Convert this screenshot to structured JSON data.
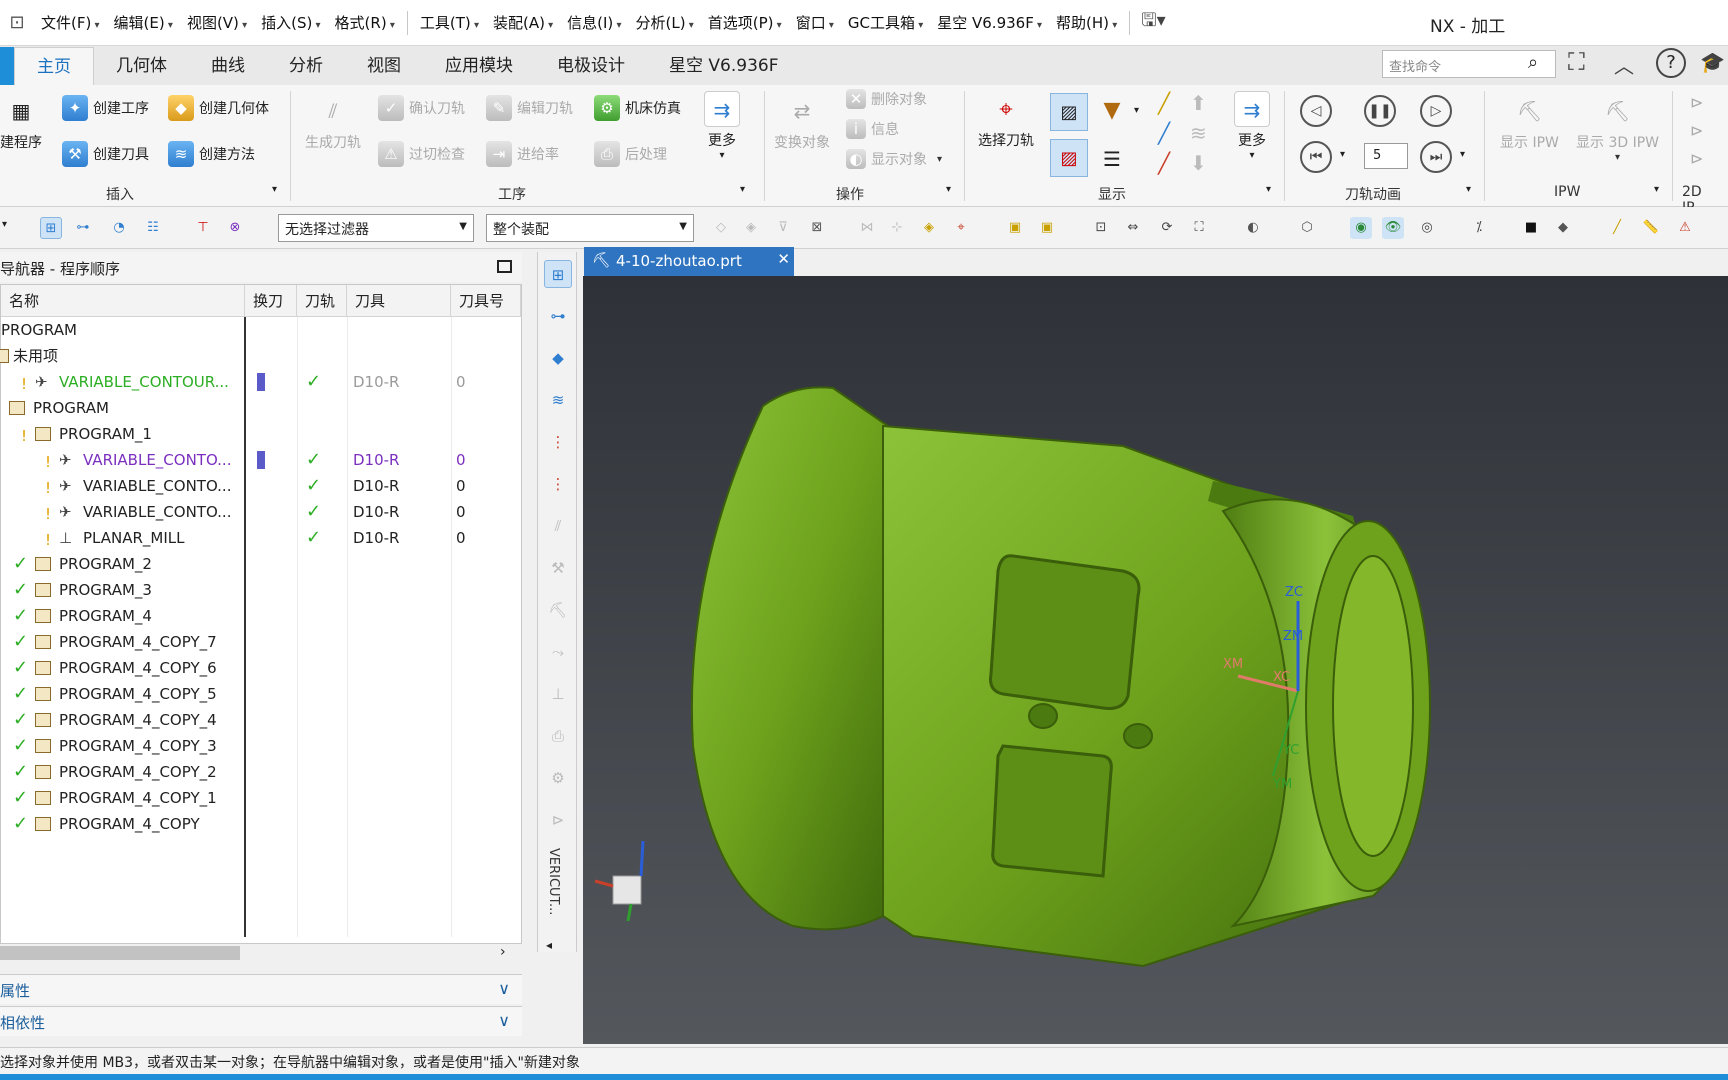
{
  "menu": [
    "文件(F)",
    "编辑(E)",
    "视图(V)",
    "插入(S)",
    "格式(R)",
    "工具(T)",
    "装配(A)",
    "信息(I)",
    "分析(L)",
    "首选项(P)",
    "窗口",
    "GC工具箱",
    "星空 V6.936F",
    "帮助(H)"
  ],
  "app_title": "NX - 加工",
  "ribbon_tabs": [
    "主页",
    "几何体",
    "曲线",
    "分析",
    "视图",
    "应用模块",
    "电极设计",
    "星空 V6.936F"
  ],
  "search_placeholder": "查找命令",
  "ribbon": {
    "insert": {
      "create_program": "建程序",
      "create_operation": "创建工序",
      "create_geometry": "创建几何体",
      "create_tool": "创建刀具",
      "create_method": "创建方法",
      "label": "插入"
    },
    "operation": {
      "generate": "生成刀轨",
      "confirm": "确认刀轨",
      "edit_path": "编辑刀轨",
      "simulate": "机床仿真",
      "overcut": "过切检查",
      "feed": "进给率",
      "post": "后处理",
      "more": "更多",
      "label": "工序"
    },
    "actions": {
      "transform": "变换对象",
      "delete": "删除对象",
      "info": "信息",
      "show": "显示对象",
      "label": "操作"
    },
    "display": {
      "select_path": "选择刀轨",
      "more": "更多",
      "label": "显示"
    },
    "animation": {
      "speed": "5",
      "label": "刀轨动画"
    },
    "ipw": {
      "show_ipw": "显示 IPW",
      "show_3d": "显示 3D IPW",
      "label": "IPW"
    },
    "ipw2d": "2D IP..."
  },
  "toolbar": {
    "filter": "无选择过滤器",
    "assembly": "整个装配"
  },
  "navigator": {
    "title": "导航器 - 程序顺序",
    "columns": {
      "name": "名称",
      "change": "换刀",
      "path": "刀轨",
      "tool": "刀具",
      "tool_no": "刀具号"
    },
    "rows": [
      {
        "name": "PROGRAM",
        "tool": "",
        "num": ""
      },
      {
        "name": "未用项",
        "tool": "",
        "num": ""
      },
      {
        "name": "VARIABLE_CONTOUR...",
        "tool": "D10-R",
        "num": "0"
      },
      {
        "name": "PROGRAM",
        "tool": "",
        "num": ""
      },
      {
        "name": "PROGRAM_1",
        "tool": "",
        "num": ""
      },
      {
        "name": "VARIABLE_CONTO...",
        "tool": "D10-R",
        "num": "0"
      },
      {
        "name": "VARIABLE_CONTO...",
        "tool": "D10-R",
        "num": "0"
      },
      {
        "name": "VARIABLE_CONTO...",
        "tool": "D10-R",
        "num": "0"
      },
      {
        "name": "PLANAR_MILL",
        "tool": "D10-R",
        "num": "0"
      },
      {
        "name": "PROGRAM_2",
        "tool": "",
        "num": ""
      },
      {
        "name": "PROGRAM_3",
        "tool": "",
        "num": ""
      },
      {
        "name": "PROGRAM_4",
        "tool": "",
        "num": ""
      },
      {
        "name": "PROGRAM_4_COPY_7",
        "tool": "",
        "num": ""
      },
      {
        "name": "PROGRAM_4_COPY_6",
        "tool": "",
        "num": ""
      },
      {
        "name": "PROGRAM_4_COPY_5",
        "tool": "",
        "num": ""
      },
      {
        "name": "PROGRAM_4_COPY_4",
        "tool": "",
        "num": ""
      },
      {
        "name": "PROGRAM_4_COPY_3",
        "tool": "",
        "num": ""
      },
      {
        "name": "PROGRAM_4_COPY_2",
        "tool": "",
        "num": ""
      },
      {
        "name": "PROGRAM_4_COPY_1",
        "tool": "",
        "num": ""
      },
      {
        "name": "PROGRAM_4_COPY",
        "tool": "",
        "num": ""
      }
    ],
    "accordion": [
      "属性",
      "相依性"
    ]
  },
  "resource_bar_label": "VERICUT...",
  "viewport": {
    "file_tab": "4-10-zhoutao.prt",
    "axes": {
      "zc": "ZC",
      "xc": "XC",
      "yc": "YC",
      "zm": "ZM",
      "xm": "XM",
      "ym": "YM"
    }
  },
  "status": "选择对象并使用 MB3，或者双击某一对象；在导航器中编辑对象，或者是使用\"插入\"新建对象",
  "colors": {
    "accent": "#1f8ed8",
    "part": "#6ea21c",
    "check": "#2cae24",
    "selected": "#7b2fbf"
  }
}
